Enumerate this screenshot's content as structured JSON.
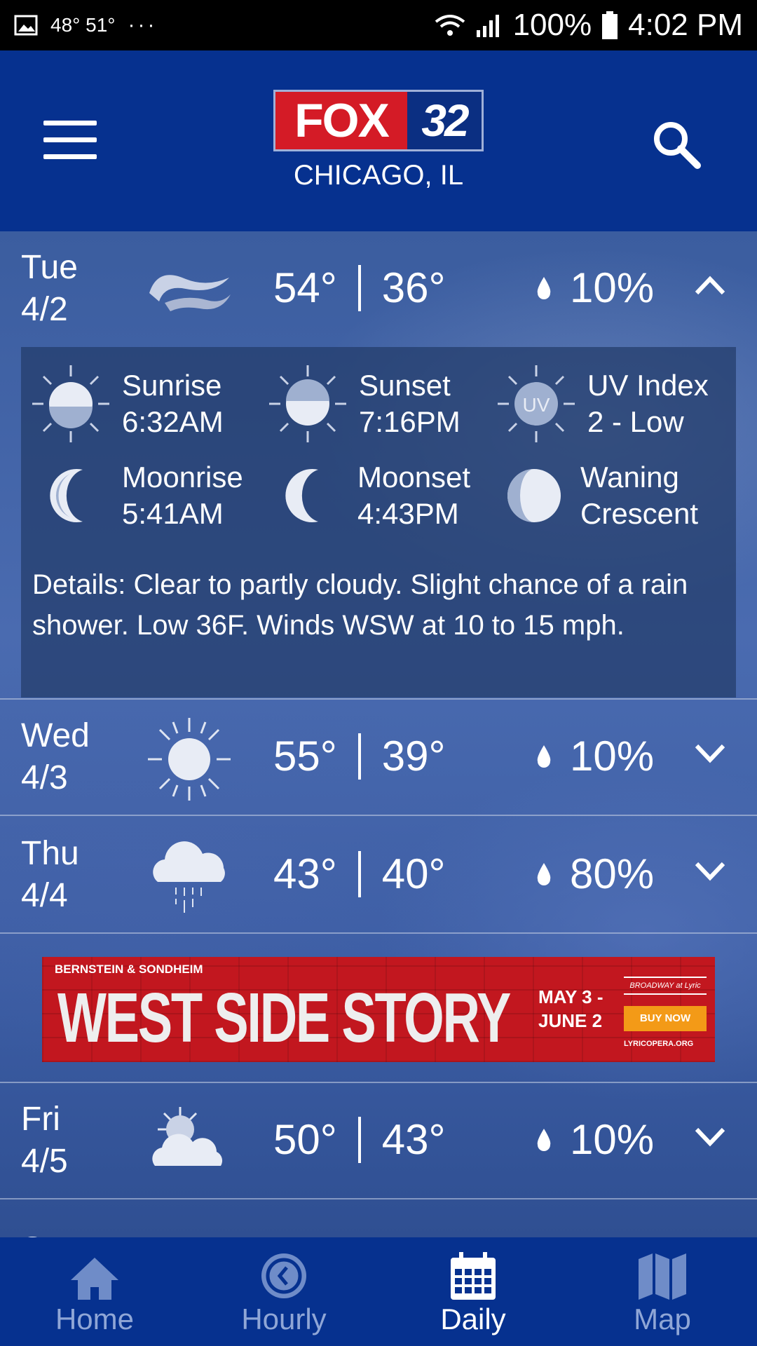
{
  "status_bar": {
    "temps": "48° 51°",
    "dots": "···",
    "battery": "100%",
    "time": "4:02 PM"
  },
  "header": {
    "logo_left": "FOX",
    "logo_right": "32",
    "city": "CHICAGO, IL"
  },
  "days": [
    {
      "name": "Tue",
      "date": "4/2",
      "icon": "wind-icon",
      "high": "54°",
      "low": "36°",
      "precip": "10%",
      "expanded": true
    },
    {
      "name": "Wed",
      "date": "4/3",
      "icon": "sun-icon",
      "high": "55°",
      "low": "39°",
      "precip": "10%",
      "expanded": false
    },
    {
      "name": "Thu",
      "date": "4/4",
      "icon": "rain-cloud-icon",
      "high": "43°",
      "low": "40°",
      "precip": "80%",
      "expanded": false
    },
    {
      "name": "Fri",
      "date": "4/5",
      "icon": "partly-cloudy-icon",
      "high": "50°",
      "low": "43°",
      "precip": "10%",
      "expanded": false
    }
  ],
  "details": {
    "sunrise_label": "Sunrise",
    "sunrise": "6:32AM",
    "sunset_label": "Sunset",
    "sunset": "7:16PM",
    "uv_label": "UV Index",
    "uv": "2 - Low",
    "uv_badge": "UV",
    "moonrise_label": "Moonrise",
    "moonrise": "5:41AM",
    "moonset_label": "Moonset",
    "moonset": "4:43PM",
    "phase_line1": "Waning",
    "phase_line2": "Crescent",
    "text": "Details: Clear to partly cloudy. Slight chance of a rain shower. Low 36F. Winds WSW at 10 to 15 mph."
  },
  "ad": {
    "top": "BERNSTEIN & SONDHEIM",
    "title": "WEST SIDE STORY",
    "dates_line1": "MAY 3 -",
    "dates_line2": "JUNE 2",
    "brand": "BROADWAY at Lyric",
    "buy": "BUY NOW",
    "site": "LYRICOPERA.ORG"
  },
  "next_day_peek": "Sat",
  "nav": {
    "home": "Home",
    "hourly": "Hourly",
    "daily": "Daily",
    "map": "Map",
    "active": "daily"
  },
  "colors": {
    "header_bg": "#06318f",
    "logo_red": "#d41b26",
    "inactive_nav": "#8fa6d6"
  }
}
